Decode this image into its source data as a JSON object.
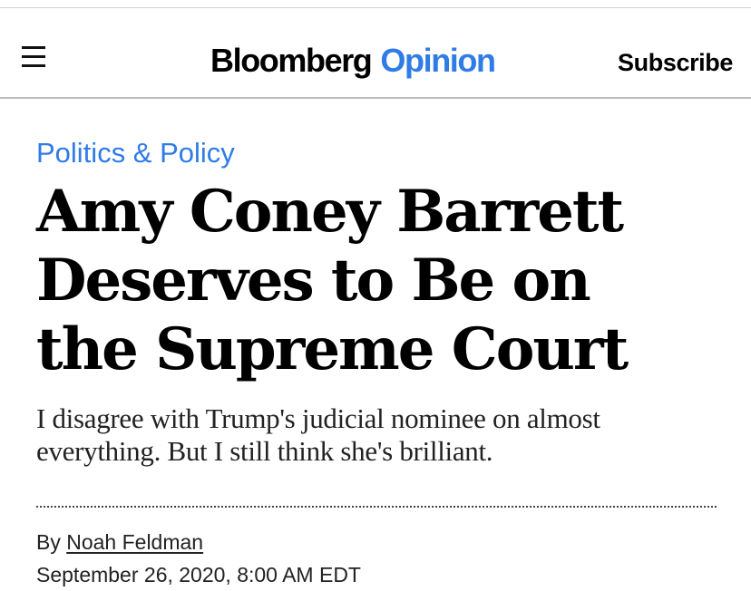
{
  "header": {
    "menu_icon": "hamburger-menu-icon",
    "brand_main": "Bloomberg",
    "brand_sub": "Opinion",
    "subscribe_label": "Subscribe"
  },
  "article": {
    "category": "Politics & Policy",
    "headline_lines": [
      "Amy Coney Barrett",
      "Deserves to Be on",
      "the Supreme Court"
    ],
    "dek_lines": [
      "I disagree with Trump's judicial nominee on almost",
      "everything. But I still think she's brilliant."
    ],
    "byline_prefix": "By",
    "author": "Noah Feldman",
    "date": "September 26, 2020, 8:00 AM EDT"
  },
  "colors": {
    "accent_blue": "#2f7ce6",
    "text": "#111111",
    "rule": "#bdbdbd"
  }
}
